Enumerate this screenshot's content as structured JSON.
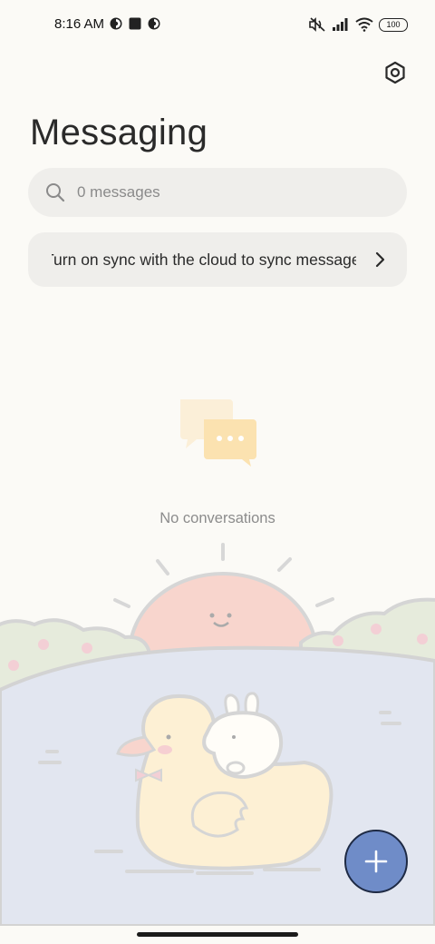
{
  "status_bar": {
    "time": "8:16 AM",
    "battery": "100",
    "icons": [
      "notification-icon",
      "square-notification-icon",
      "notification-icon",
      "mute-icon",
      "signal-icon",
      "wifi-icon",
      "battery-icon"
    ]
  },
  "header": {
    "title": "Messaging",
    "settings_icon": "settings-icon"
  },
  "search": {
    "placeholder": "0 messages",
    "icon": "search-icon"
  },
  "sync_banner": {
    "text": "Turn on sync with the cloud to sync messages"
  },
  "empty_state": {
    "icon": "chat-bubbles-icon",
    "label": "No conversations"
  },
  "fab": {
    "icon": "plus-icon"
  },
  "colors": {
    "background": "#fbfaf6",
    "surface": "#efeeeb",
    "accent": "#6f8cc8",
    "lake": "#e2e6f0",
    "sun": "#f7d3cc",
    "bush": "#e6ebdc"
  }
}
